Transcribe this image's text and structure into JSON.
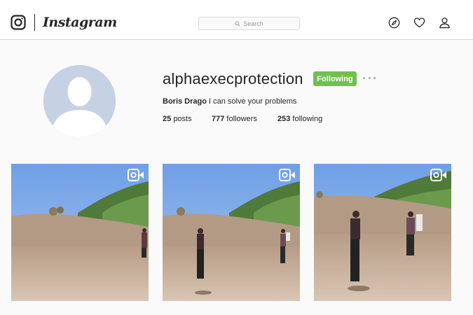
{
  "header": {
    "brand": "Instagram",
    "search": {
      "placeholder": "Search"
    },
    "icons": [
      "instagram-logo-icon",
      "search-icon",
      "compass-icon",
      "heart-icon",
      "user-icon"
    ]
  },
  "profile": {
    "username": "alphaexecprotection",
    "follow_button": "Following",
    "full_name": "Boris Drago",
    "bio": "I can solve your problems",
    "stats": {
      "posts_count": "25",
      "posts_label": "posts",
      "followers_count": "777",
      "followers_label": "followers",
      "following_count": "253",
      "following_label": "following"
    }
  },
  "posts": [
    {
      "type": "video",
      "icon": "video-camera-icon"
    },
    {
      "type": "video",
      "icon": "video-camera-icon"
    },
    {
      "type": "video",
      "icon": "video-camera-icon"
    }
  ],
  "colors": {
    "following_green": "#70c050",
    "background": "#fafafa",
    "header_border": "#dbdbdb",
    "text": "#262626",
    "avatar_bg": "#c6d1e3"
  }
}
